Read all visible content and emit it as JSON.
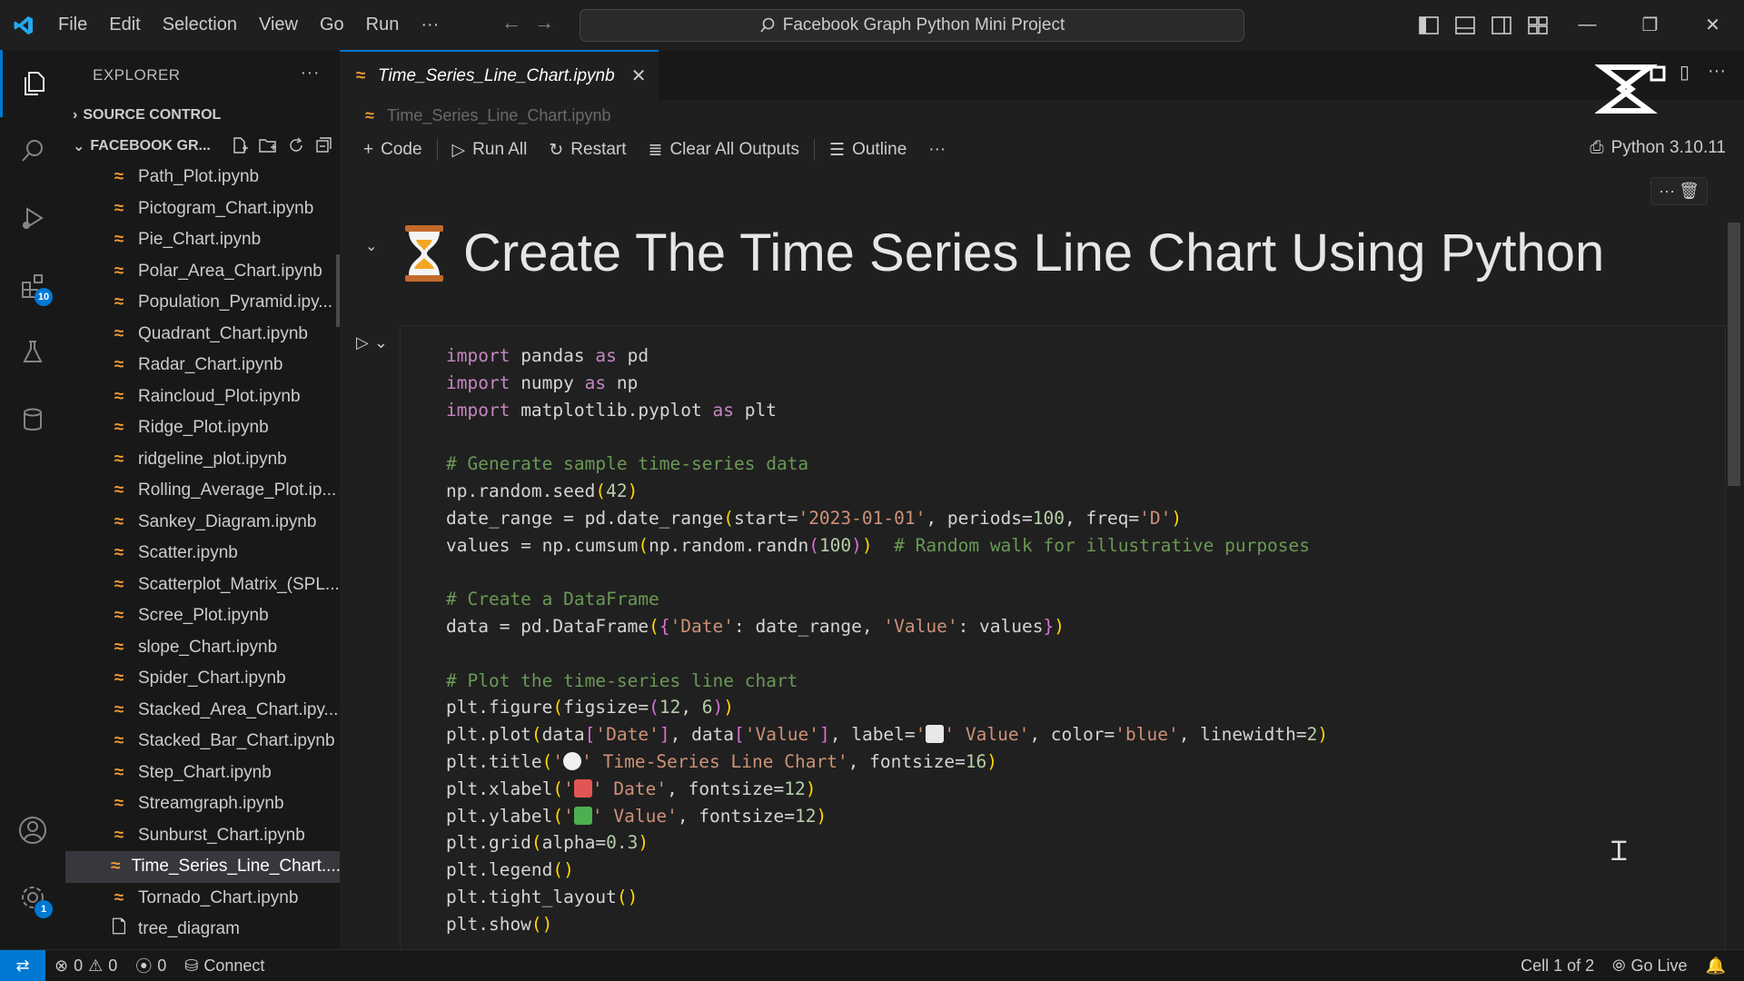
{
  "titlebar": {
    "menu": [
      "File",
      "Edit",
      "Selection",
      "View",
      "Go",
      "Run",
      "···"
    ],
    "search": "Facebook Graph Python Mini Project",
    "window_buttons": [
      "—",
      "❐",
      "✕"
    ]
  },
  "activity": {
    "extensions_badge": "10",
    "settings_badge": "1"
  },
  "sidebar": {
    "header": "EXPLORER",
    "more": "···",
    "source_control": "SOURCE CONTROL",
    "folder": "FACEBOOK GR...",
    "files": [
      "Path_Plot.ipynb",
      "Pictogram_Chart.ipynb",
      "Pie_Chart.ipynb",
      "Polar_Area_Chart.ipynb",
      "Population_Pyramid.ipy...",
      "Quadrant_Chart.ipynb",
      "Radar_Chart.ipynb",
      "Raincloud_Plot.ipynb",
      "Ridge_Plot.ipynb",
      "ridgeline_plot.ipynb",
      "Rolling_Average_Plot.ip...",
      "Sankey_Diagram.ipynb",
      "Scatter.ipynb",
      "Scatterplot_Matrix_(SPL...",
      "Scree_Plot.ipynb",
      "slope_Chart.ipynb",
      "Spider_Chart.ipynb",
      "Stacked_Area_Chart.ipy...",
      "Stacked_Bar_Chart.ipynb",
      "Step_Chart.ipynb",
      "Streamgraph.ipynb",
      "Sunburst_Chart.ipynb",
      "Time_Series_Line_Chart....",
      "Tornado_Chart.ipynb",
      "tree_diagram"
    ]
  },
  "editor": {
    "tab": "Time_Series_Line_Chart.ipynb",
    "breadcrumb": "Time_Series_Line_Chart.ipynb",
    "toolbar": {
      "code": "Code",
      "run_all": "Run All",
      "restart": "Restart",
      "clear": "Clear All Outputs",
      "outline": "Outline",
      "more": "···",
      "kernel": "Python 3.10.11"
    },
    "md_title": "Create The Time Series Line Chart Using Python"
  },
  "code": {
    "l1a": "import",
    "l1b": " pandas ",
    "l1c": "as",
    "l1d": " pd",
    "l2a": "import",
    "l2b": " numpy ",
    "l2c": "as",
    "l2d": " np",
    "l3a": "import",
    "l3b": " matplotlib.pyplot ",
    "l3c": "as",
    "l3d": " plt",
    "c1": "# Generate sample time-series data",
    "l5a": "np.random.seed",
    "l5b": "42",
    "l6a": "date_range = pd.date_range",
    "l6b": "start=",
    "l6c": "'2023-01-01'",
    "l6d": ", periods=",
    "l6e": "100",
    "l6f": ", freq=",
    "l6g": "'D'",
    "l7a": "values = np.cumsum",
    "l7b": "np.random.randn",
    "l7c": "100",
    "l7d": "# Random walk for illustrative purposes",
    "c2": "# Create a DataFrame",
    "l9a": "data = pd.DataFrame",
    "l9b": "'Date'",
    "l9c": ": date_range, ",
    "l9d": "'Value'",
    "l9e": ": values",
    "c3": "# Plot the time-series line chart",
    "l11a": "plt.figure",
    "l11b": "figsize=",
    "l11c": "12",
    "l11d": ", ",
    "l11e": "6",
    "l12a": "plt.plot",
    "l12b": "data",
    "l12c": "'Date'",
    "l12d": ", data",
    "l12e": "'Value'",
    "l12f": ", label=",
    "l12g": "' Value'",
    "l12h": ", color=",
    "l12i": "'blue'",
    "l12j": ", linewidth=",
    "l12k": "2",
    "l13a": "plt.title",
    "l13b": "' Time-Series Line Chart'",
    "l13c": ", fontsize=",
    "l13d": "16",
    "l14a": "plt.xlabel",
    "l14b": "' Date'",
    "l14c": ", fontsize=",
    "l14d": "12",
    "l15a": "plt.ylabel",
    "l15b": "' Value'",
    "l15c": ", fontsize=",
    "l15d": "12",
    "l16a": "plt.grid",
    "l16b": "alpha=",
    "l16c": "0.3",
    "l17a": "plt.legend",
    "l18a": "plt.tight_layout",
    "l19a": "plt.show"
  },
  "status": {
    "errors": "0",
    "warnings": "0",
    "ports": "0",
    "connect": "Connect",
    "cell": "Cell 1 of 2",
    "golive": "Go Live"
  },
  "colors": {
    "accent": "#0078d4",
    "notebook_icon": "#f29b32"
  }
}
